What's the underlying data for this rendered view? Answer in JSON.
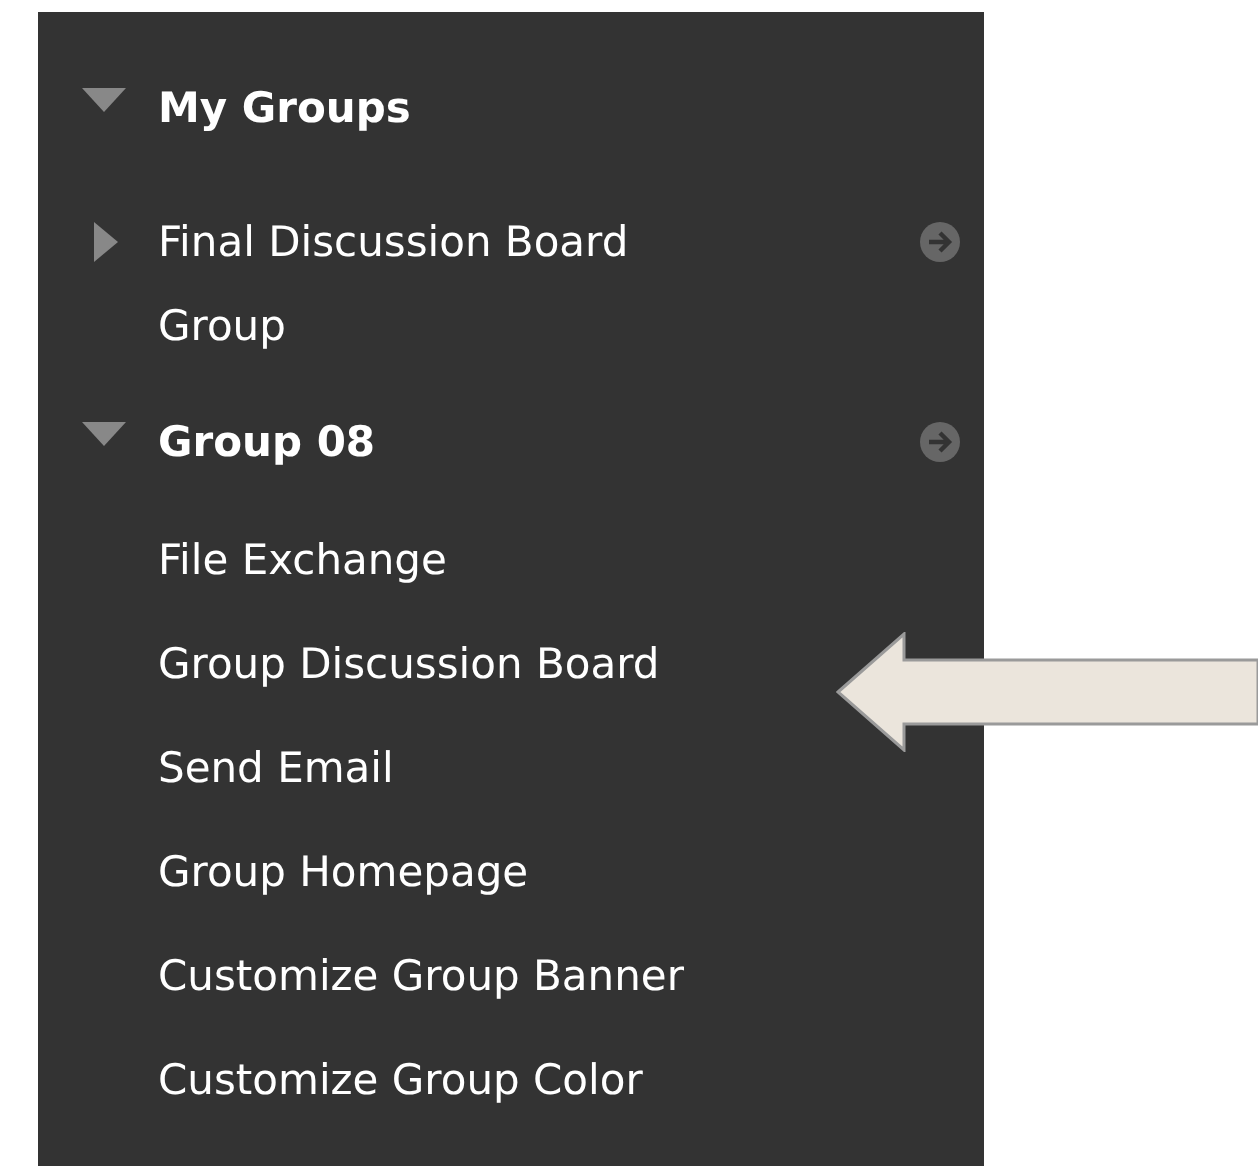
{
  "heading": {
    "label": "My Groups",
    "expanded": true
  },
  "groups": [
    {
      "label": "Final Discussion Board Group",
      "expanded": false
    },
    {
      "label": "Group 08",
      "expanded": true,
      "children": [
        {
          "label": "File Exchange"
        },
        {
          "label": "Group Discussion Board"
        },
        {
          "label": "Send Email"
        },
        {
          "label": "Group Homepage"
        },
        {
          "label": "Customize Group Banner"
        },
        {
          "label": "Customize Group Color"
        }
      ]
    }
  ]
}
